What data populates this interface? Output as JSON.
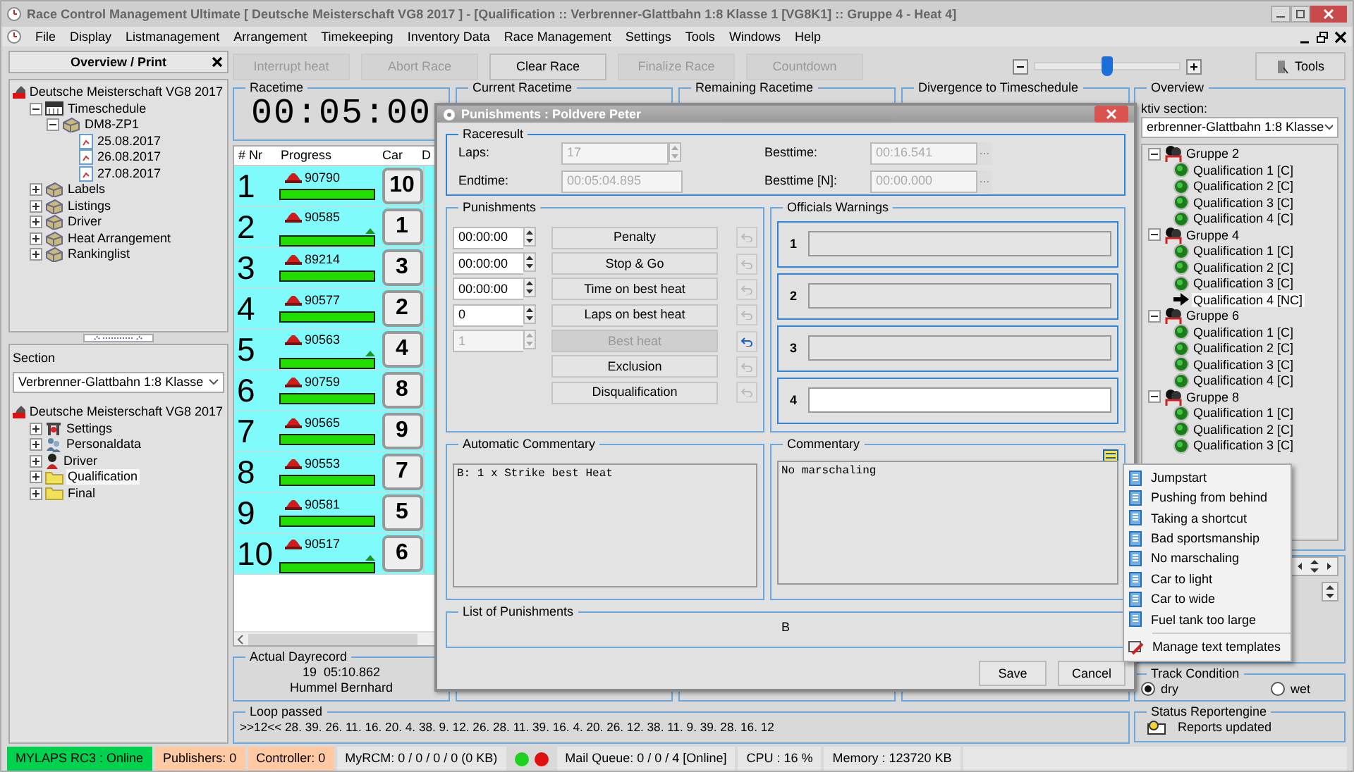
{
  "window": {
    "title": "Race Control Management Ultimate  [ Deutsche Meisterschaft VG8 2017 ] - [Qualification :: Verbrenner-Glattbahn 1:8 Klasse 1  [VG8K1] :: Gruppe 4 - Heat 4]"
  },
  "menu": [
    {
      "label": "File"
    },
    {
      "label": "Display"
    },
    {
      "label": "Listmanagement"
    },
    {
      "label": "Arrangement"
    },
    {
      "label": "Timekeeping"
    },
    {
      "label": "Inventory Data"
    },
    {
      "label": "Race Management"
    },
    {
      "label": "Settings"
    },
    {
      "label": "Tools"
    },
    {
      "label": "Windows"
    },
    {
      "label": "Help"
    }
  ],
  "toolbar": {
    "buttons": [
      {
        "label": "Interrupt heat",
        "disabled": true
      },
      {
        "label": "Abort Race",
        "disabled": true
      },
      {
        "label": "Clear Race",
        "disabled": false
      },
      {
        "label": "Finalize Race",
        "disabled": true
      },
      {
        "label": "Countdown",
        "disabled": true
      }
    ],
    "zoom": {
      "level": 0.5
    },
    "tools_button": "Tools"
  },
  "overview_panel": {
    "title": "Overview / Print",
    "tree": [
      {
        "label": "Deutsche Meisterschaft VG8 2017",
        "kind": "event",
        "children": [
          {
            "label": "Timeschedule",
            "kind": "schedule",
            "expanded": true,
            "children": [
              {
                "label": "DM8-ZP1",
                "kind": "box",
                "expanded": true,
                "children": [
                  {
                    "label": "25.08.2017",
                    "kind": "day"
                  },
                  {
                    "label": "26.08.2017",
                    "kind": "day"
                  },
                  {
                    "label": "27.08.2017",
                    "kind": "day"
                  }
                ]
              }
            ]
          },
          {
            "label": "Labels",
            "kind": "box",
            "expanded": false
          },
          {
            "label": "Listings",
            "kind": "box",
            "expanded": false
          },
          {
            "label": "Driver",
            "kind": "box",
            "expanded": false
          },
          {
            "label": "Heat Arrangement",
            "kind": "box",
            "expanded": false
          },
          {
            "label": "Rankinglist",
            "kind": "box",
            "expanded": false
          }
        ]
      }
    ]
  },
  "section": {
    "label": "Section",
    "value": "Verbrenner-Glattbahn 1:8 Klasse",
    "tree": [
      {
        "label": "Deutsche Meisterschaft VG8 2017",
        "kind": "event",
        "selected": false,
        "children": [
          {
            "label": "Settings",
            "kind": "settings",
            "expanded": false,
            "selected": false
          },
          {
            "label": "Personaldata",
            "kind": "people",
            "expanded": false,
            "selected": false
          },
          {
            "label": "Driver",
            "kind": "driver",
            "expanded": false,
            "selected": false
          },
          {
            "label": "Qualification",
            "kind": "folder",
            "expanded": false,
            "selected": true
          },
          {
            "label": "Final",
            "kind": "folder",
            "expanded": false,
            "selected": false
          }
        ]
      }
    ]
  },
  "timers": [
    {
      "title": "Racetime",
      "value": "00:05:00"
    },
    {
      "title": "Current Racetime"
    },
    {
      "title": "Remaining Racetime"
    },
    {
      "title": "Divergence to Timeschedule"
    }
  ],
  "race_table": {
    "columns": [
      "# Nr",
      "Progress",
      "Car",
      "D"
    ],
    "rows": [
      {
        "nr": "1",
        "transponder": "90790",
        "level": 1,
        "gained": false,
        "car": "10"
      },
      {
        "nr": "2",
        "transponder": "90585",
        "level": 1,
        "gained": true,
        "car": "1"
      },
      {
        "nr": "3",
        "transponder": "89214",
        "level": 1,
        "gained": false,
        "car": "3"
      },
      {
        "nr": "4",
        "transponder": "90577",
        "level": 1,
        "gained": false,
        "car": "2"
      },
      {
        "nr": "5",
        "transponder": "90563",
        "level": 1,
        "gained": true,
        "car": "4"
      },
      {
        "nr": "6",
        "transponder": "90759",
        "level": 1,
        "gained": false,
        "car": "8"
      },
      {
        "nr": "7",
        "transponder": "90565",
        "level": 1,
        "gained": false,
        "car": "9"
      },
      {
        "nr": "8",
        "transponder": "90553",
        "level": 1,
        "gained": false,
        "car": "7"
      },
      {
        "nr": "9",
        "transponder": "90581",
        "level": 1,
        "gained": false,
        "car": "5"
      },
      {
        "nr": "10",
        "transponder": "90517",
        "level": 1,
        "gained": true,
        "car": "6"
      }
    ]
  },
  "dayrecord": {
    "title": "Actual Dayrecord",
    "record": "19  05:10.862",
    "driver": "Hummel Bernhard"
  },
  "loop": {
    "title": "Loop passed",
    "text": ">>12<< 28. 39. 26. 11. 16. 20. 4. 38. 9. 12. 26. 28. 11. 39. 16. 4. 20. 26. 12. 38. 11. 9. 39. 28. 16. 12"
  },
  "overview": {
    "title": "Overview",
    "section_label": "ktiv section:",
    "section_value": "erbrenner-Glattbahn 1:8 Klasse",
    "groups": [
      {
        "label": "Gruppe 2",
        "expanded": true,
        "children": [
          {
            "label": "Qualification 1  [C]",
            "kind": "done",
            "selected": false
          },
          {
            "label": "Qualification 2  [C]",
            "kind": "done",
            "selected": false
          },
          {
            "label": "Qualification 3  [C]",
            "kind": "done",
            "selected": false
          },
          {
            "label": "Qualification 4  [C]",
            "kind": "done",
            "selected": false
          }
        ]
      },
      {
        "label": "Gruppe 4",
        "expanded": true,
        "children": [
          {
            "label": "Qualification 1  [C]",
            "kind": "done",
            "selected": false
          },
          {
            "label": "Qualification 2  [C]",
            "kind": "done",
            "selected": false
          },
          {
            "label": "Qualification 3  [C]",
            "kind": "done",
            "selected": false
          },
          {
            "label": "Qualification 4  [NC]",
            "kind": "current",
            "selected": true
          }
        ]
      },
      {
        "label": "Gruppe 6",
        "expanded": true,
        "children": [
          {
            "label": "Qualification 1  [C]",
            "kind": "done",
            "selected": false
          },
          {
            "label": "Qualification 2  [C]",
            "kind": "done",
            "selected": false
          },
          {
            "label": "Qualification 3  [C]",
            "kind": "done",
            "selected": false
          },
          {
            "label": "Qualification 4  [C]",
            "kind": "done",
            "selected": false
          }
        ]
      },
      {
        "label": "Gruppe 8",
        "expanded": true,
        "children": [
          {
            "label": "Qualification 1  [C]",
            "kind": "done",
            "selected": false
          },
          {
            "label": "Qualification 2  [C]",
            "kind": "done",
            "selected": false
          },
          {
            "label": "Qualification 3  [C]",
            "kind": "done",
            "selected": false
          }
        ]
      }
    ]
  },
  "track_condition": {
    "title": "Track Condition",
    "options": [
      {
        "label": "dry",
        "selected": true
      },
      {
        "label": "wet",
        "selected": false
      }
    ]
  },
  "report_engine": {
    "title": "Status Reportengine",
    "text": "Reports updated"
  },
  "status_bar": [
    {
      "kind": "text",
      "text": "MYLAPS RC3 : Online",
      "color": "#00d24f"
    },
    {
      "kind": "text",
      "text": "Publishers: 0",
      "color": "#ffc9a3"
    },
    {
      "kind": "text",
      "text": "Controller: 0",
      "color": "#ffc9a3"
    },
    {
      "kind": "text",
      "text": "MyRCM: 0 / 0 / 0 / 0 (0 KB)"
    },
    {
      "kind": "lights",
      "lights": [
        {
          "color": "#1fd11f"
        },
        {
          "color": "#e01010"
        }
      ]
    },
    {
      "kind": "text",
      "text": "Mail Queue: 0 / 0 / 4 [Online]"
    },
    {
      "kind": "text",
      "text": "CPU : 16 %"
    },
    {
      "kind": "text",
      "text": "Memory : 123720 KB"
    }
  ],
  "dialog": {
    "title": "Punishments : Poldvere Peter",
    "raceresult": {
      "title": "Raceresult",
      "left": [
        {
          "label": "Laps:",
          "value": "17",
          "kind": "spin"
        },
        {
          "label": "Endtime:",
          "value": "00:05:04.895",
          "kind": "text"
        }
      ],
      "right": [
        {
          "label": "Besttime:",
          "value": "00:16.541",
          "kind": "picker"
        },
        {
          "label": "Besttime [N]:",
          "value": "00:00.000",
          "kind": "picker"
        }
      ]
    },
    "punishments": {
      "title": "Punishments",
      "rows": [
        {
          "kind": "spin",
          "value": "00:00:00",
          "field_disabled": false,
          "label": "Penalty",
          "disabled": false,
          "undo_enabled": false
        },
        {
          "kind": "spin",
          "value": "00:00:00",
          "field_disabled": false,
          "label": "Stop & Go",
          "disabled": false,
          "undo_enabled": false
        },
        {
          "kind": "spin",
          "value": "00:00:00",
          "field_disabled": false,
          "label": "Time on best heat",
          "disabled": false,
          "undo_enabled": false
        },
        {
          "kind": "spin",
          "value": "0",
          "field_disabled": false,
          "label": "Laps on best heat",
          "disabled": false,
          "undo_enabled": false
        },
        {
          "kind": "spin",
          "value": "1",
          "field_disabled": true,
          "label": "Best heat",
          "disabled": true,
          "undo_enabled": true
        },
        {
          "kind": "button",
          "label": "Exclusion",
          "disabled": false,
          "undo_enabled": false
        },
        {
          "kind": "button",
          "label": "Disqualification",
          "disabled": false,
          "undo_enabled": false
        }
      ]
    },
    "warnings": {
      "title": "Officials Warnings",
      "items": [
        {
          "number": "1",
          "enabled": false
        },
        {
          "number": "2",
          "enabled": false
        },
        {
          "number": "3",
          "enabled": false
        },
        {
          "number": "4",
          "enabled": true
        }
      ]
    },
    "auto_commentary": {
      "title": "Automatic Commentary",
      "text": "B: 1 x Strike best Heat"
    },
    "commentary": {
      "title": "Commentary",
      "text": "No marschaling"
    },
    "list": {
      "title": "List of Punishments",
      "text": "B"
    },
    "buttons": [
      "Save",
      "Cancel"
    ]
  },
  "template_menu": {
    "items": [
      "Jumpstart",
      "Pushing from behind",
      "Taking a shortcut",
      "Bad sportsmanship",
      "No marschaling",
      "Car to light",
      "Car to wide",
      "Fuel tank too large"
    ],
    "manage": "Manage text templates"
  }
}
